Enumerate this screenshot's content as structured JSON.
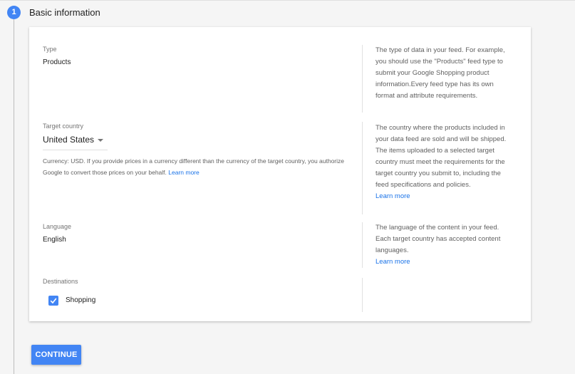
{
  "step": {
    "number": "1",
    "title": "Basic information"
  },
  "type_field": {
    "label": "Type",
    "value": "Products",
    "help": "The type of data in your feed. For example, you should use the \"Products\" feed type to submit your Google Shopping product information.Every feed type has its own format and attribute requirements."
  },
  "country_field": {
    "label": "Target country",
    "value": "United States",
    "currency_note": "Currency: USD. If you provide prices in a currency different than the currency of the target country, you authorize Google to convert those prices on your behalf.",
    "currency_link": "Learn more",
    "help": "The country where the products included in your data feed are sold and will be shipped. The items uploaded to a selected target country must meet the requirements for the target country you submit to, including the feed specifications and policies.",
    "help_link": "Learn more"
  },
  "language_field": {
    "label": "Language",
    "value": "English",
    "help": "The language of the content in your feed. Each target country has accepted content languages.",
    "help_link": "Learn more"
  },
  "destinations": {
    "label": "Destinations",
    "options": [
      {
        "label": "Shopping",
        "checked": true
      }
    ]
  },
  "continue_label": "CONTINUE",
  "colors": {
    "accent": "#4285f4",
    "link": "#1a73e8"
  }
}
